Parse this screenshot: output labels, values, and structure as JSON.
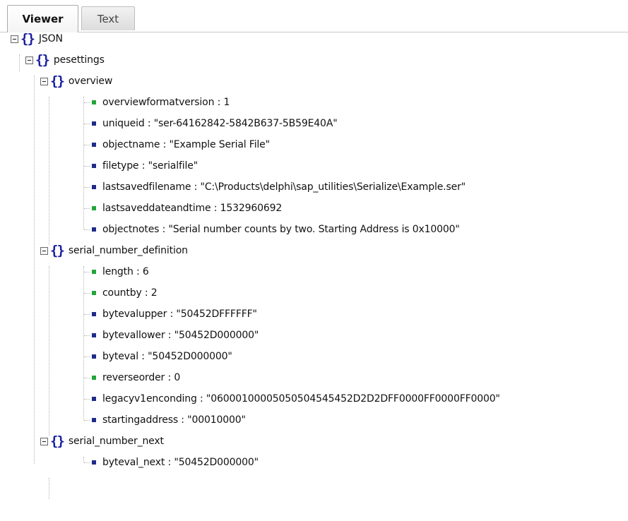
{
  "tabs": {
    "viewer": "Viewer",
    "text": "Text"
  },
  "tree": {
    "root": "JSON",
    "pesettings": "pesettings",
    "overview": {
      "label": "overview",
      "items": [
        "overviewformatversion : 1",
        "uniqueid : \"ser-64162842-5842B637-5B59E40A\"",
        "objectname : \"Example Serial File\"",
        "filetype : \"serialfile\"",
        "lastsavedfilename : \"C:\\Products\\delphi\\sap_utilities\\Serialize\\Example.ser\"",
        "lastsaveddateandtime : 1532960692",
        "objectnotes : \"Serial number counts by two. Starting Address is 0x10000\""
      ]
    },
    "serial_number_definition": {
      "label": "serial_number_definition",
      "items": [
        "length : 6",
        "countby : 2",
        "bytevalupper : \"50452DFFFFFF\"",
        "bytevallower : \"50452D000000\"",
        "byteval : \"50452D000000\"",
        "reverseorder : 0",
        "legacyv1enconding : \"06000100005050504545452D2D2DFF0000FF0000FF0000\"",
        "startingaddress : \"00010000\""
      ]
    },
    "serial_number_next": {
      "label": "serial_number_next",
      "items": [
        "byteval_next : \"50452D000000\""
      ]
    }
  },
  "colors": {
    "number_bullet": "#22a53a",
    "string_bullet": "#1f2b8a",
    "object_icon": "#1b1f9e"
  },
  "icons": {
    "expanded": "collapse-minus-icon",
    "object": "object-braces-icon",
    "number": "number-value-icon",
    "string": "string-value-icon"
  }
}
